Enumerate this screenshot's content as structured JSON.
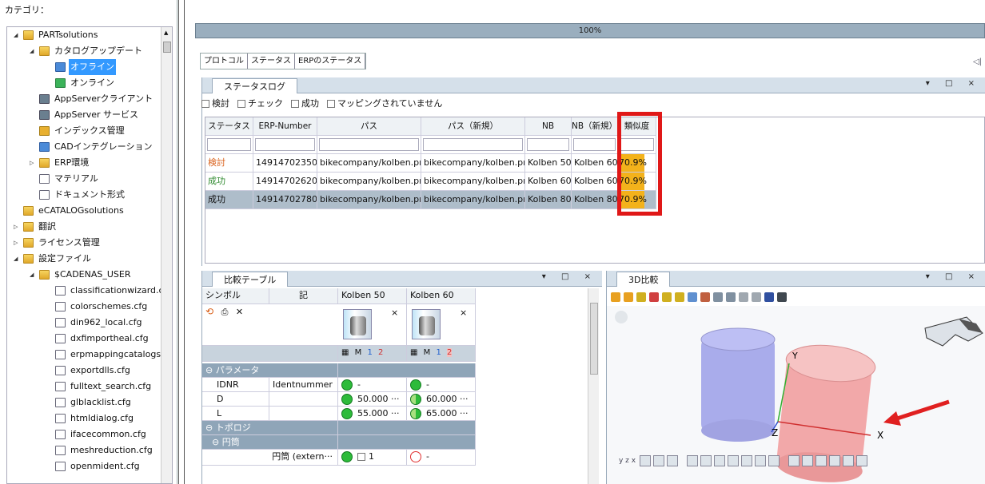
{
  "sidebar": {
    "title": "カテゴリ：",
    "tree": [
      {
        "label": "PARTsolutions",
        "icon": "folder-icon",
        "level": 0,
        "expand": "expanded"
      },
      {
        "label": "カタログアップデート",
        "icon": "folder-icon",
        "level": 1,
        "expand": "expanded"
      },
      {
        "label": "オフライン",
        "icon": "catalog-offline-icon",
        "level": 2,
        "selected": true
      },
      {
        "label": "オンライン",
        "icon": "catalog-online-icon",
        "level": 2
      },
      {
        "label": "AppServerクライアント",
        "icon": "app-server-icon",
        "level": 1
      },
      {
        "label": "AppServer サービス",
        "icon": "app-server-icon",
        "level": 1
      },
      {
        "label": "インデックス管理",
        "icon": "index-icon",
        "level": 1
      },
      {
        "label": "CADインテグレーション",
        "icon": "cad-integration-icon",
        "level": 1
      },
      {
        "label": "ERP環境",
        "icon": "folder-icon",
        "level": 1,
        "expand": "collapsed"
      },
      {
        "label": "マテリアル",
        "icon": "document-icon",
        "level": 1
      },
      {
        "label": "ドキュメント形式",
        "icon": "document-icon",
        "level": 1
      },
      {
        "label": "eCATALOGsolutions",
        "icon": "folder-icon",
        "level": 0
      },
      {
        "label": "翻訳",
        "icon": "folder-icon",
        "level": 0,
        "expand": "collapsed"
      },
      {
        "label": "ライセンス管理",
        "icon": "folder-icon",
        "level": 0,
        "expand": "collapsed"
      },
      {
        "label": "設定ファイル",
        "icon": "folder-icon",
        "level": 0,
        "expand": "expanded"
      },
      {
        "label": "$CADENAS_USER",
        "icon": "folder-icon",
        "level": 1,
        "expand": "expanded"
      },
      {
        "label": "classificationwizard.cfg",
        "icon": "document-icon",
        "level": 2
      },
      {
        "label": "colorschemes.cfg",
        "icon": "document-icon",
        "level": 2
      },
      {
        "label": "din962_local.cfg",
        "icon": "document-icon",
        "level": 2
      },
      {
        "label": "dxfimportheal.cfg",
        "icon": "document-icon",
        "level": 2
      },
      {
        "label": "erpmappingcatalogs.cfg",
        "icon": "document-icon",
        "level": 2
      },
      {
        "label": "exportdlls.cfg",
        "icon": "document-icon",
        "level": 2
      },
      {
        "label": "fulltext_search.cfg",
        "icon": "document-icon",
        "level": 2
      },
      {
        "label": "glblacklist.cfg",
        "icon": "document-icon",
        "level": 2
      },
      {
        "label": "htmldialog.cfg",
        "icon": "document-icon",
        "level": 2
      },
      {
        "label": "ifacecommon.cfg",
        "icon": "document-icon",
        "level": 2
      },
      {
        "label": "meshreduction.cfg",
        "icon": "document-icon",
        "level": 2
      },
      {
        "label": "openmident.cfg",
        "icon": "document-icon",
        "level": 2
      }
    ]
  },
  "progress": {
    "label": "100%",
    "value": 1.0
  },
  "tabs": [
    "プロトコル",
    "ステータス",
    "ERPのステータス"
  ],
  "statuslog": {
    "title": "ステータスログ",
    "controls": "▾ □ ×",
    "filters": [
      "検討",
      "チェック",
      "成功",
      "マッピングされていません"
    ],
    "columns": [
      "ステータス",
      "ERP-Number",
      "パス",
      "パス（新規）",
      "NB",
      "NB（新規）",
      "類似度"
    ],
    "rows": [
      {
        "status": "検討",
        "status_color": "#d9601a",
        "erp": "14914702350",
        "path": "bikecompany/kolben.prj",
        "path_new": "bikecompany/kolben.prj",
        "nb": "Kolben 50",
        "nb_new": "Kolben 60",
        "similarity": "70.9%",
        "sim_value": 0.709
      },
      {
        "status": "成功",
        "status_color": "#2f8a2f",
        "erp": "14914702620",
        "path": "bikecompany/kolben.prj",
        "path_new": "bikecompany/kolben.prj",
        "nb": "Kolben 60",
        "nb_new": "Kolben 60",
        "similarity": "70.9%",
        "sim_value": 0.709
      },
      {
        "status": "成功",
        "status_color": "#111111",
        "erp": "14914702780",
        "path": "bikecompany/kolben.prj",
        "path_new": "bikecompany/kolben.prj",
        "nb": "Kolben 80",
        "nb_new": "Kolben 80",
        "similarity": "70.9%",
        "sim_value": 0.709,
        "selected": true
      }
    ]
  },
  "compare": {
    "title": "比較テーブル",
    "controls": "▾ □ ×",
    "col_symbol": "シンボル",
    "col_note": "記",
    "col_a": "Kolben 50",
    "col_b": "Kolben 60",
    "close_mark": "×",
    "variant_a": [
      "M",
      "1",
      "2"
    ],
    "variant_b": [
      "M",
      "1",
      "2"
    ],
    "sec_params": "パラメータ",
    "params": [
      {
        "name": "IDNR",
        "desc": "Identnummer",
        "a": "-",
        "b": "-",
        "b_dot": "full"
      },
      {
        "name": "D",
        "desc": "",
        "a": "50.000 ···",
        "b": "60.000 ···",
        "b_dot": "half"
      },
      {
        "name": "L",
        "desc": "",
        "a": "55.000 ···",
        "b": "65.000 ···",
        "b_dot": "half"
      }
    ],
    "sec_topology": "トポロジ",
    "sec_cylinder": "円筒",
    "topo_row": {
      "name": "円筒 (extern···",
      "a": "1",
      "b": "-"
    }
  },
  "viewer3d": {
    "title": "3D比較",
    "controls": "▾ □ ×",
    "axis_x": "X",
    "axis_y": "Y",
    "axis_z": "Z",
    "mini_axis": "y z x"
  }
}
